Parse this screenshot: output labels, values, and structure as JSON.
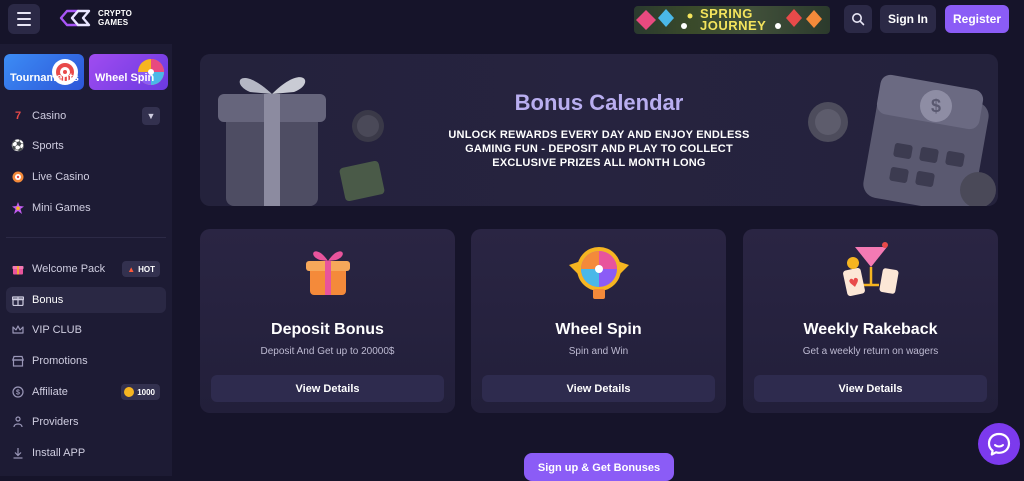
{
  "header": {
    "logo_line1": "CRYPTO",
    "logo_line2": "GAMES",
    "promo_line1": "SPRING",
    "promo_line2": "JOURNEY",
    "signin_label": "Sign In",
    "register_label": "Register"
  },
  "sidebar": {
    "promos": [
      {
        "label": "Tournaments"
      },
      {
        "label": "Wheel Spin"
      }
    ],
    "items": [
      {
        "label": "Casino",
        "icon": "casino-seven-icon"
      },
      {
        "label": "Sports",
        "icon": "soccer-ball-icon"
      },
      {
        "label": "Live Casino",
        "icon": "roulette-icon"
      },
      {
        "label": "Mini Games",
        "icon": "explosion-icon"
      },
      {
        "label": "Welcome Pack",
        "icon": "gift-icon",
        "badge": "HOT"
      },
      {
        "label": "Bonus",
        "icon": "gift-box-icon"
      },
      {
        "label": "VIP CLUB",
        "icon": "crown-icon"
      },
      {
        "label": "Promotions",
        "icon": "shop-icon"
      },
      {
        "label": "Affiliate",
        "icon": "affiliate-icon",
        "badge": "1000"
      },
      {
        "label": "Providers",
        "icon": "providers-icon"
      },
      {
        "label": "Install APP",
        "icon": "download-icon"
      }
    ]
  },
  "banner": {
    "title": "Bonus Calendar",
    "subtitle": "UNLOCK REWARDS EVERY DAY AND ENJOY ENDLESS GAMING FUN - DEPOSIT AND PLAY TO COLLECT EXCLUSIVE PRIZES ALL MONTH LONG"
  },
  "cards": [
    {
      "title": "Deposit Bonus",
      "subtitle": "Deposit And Get up to 20000$",
      "button": "View Details",
      "icon": "gift-icon"
    },
    {
      "title": "Wheel Spin",
      "subtitle": "Spin and Win",
      "button": "View Details",
      "icon": "fortune-wheel-icon"
    },
    {
      "title": "Weekly Rakeback",
      "subtitle": "Get a weekly return on wagers",
      "button": "View Details",
      "icon": "cocktail-cards-icon"
    }
  ],
  "cta": {
    "label": "Sign up & Get Bonuses"
  },
  "colors": {
    "accent": "#8b5cf6",
    "background": "#16142a",
    "sidebar": "#1d1b34",
    "card": "#2a2543"
  }
}
